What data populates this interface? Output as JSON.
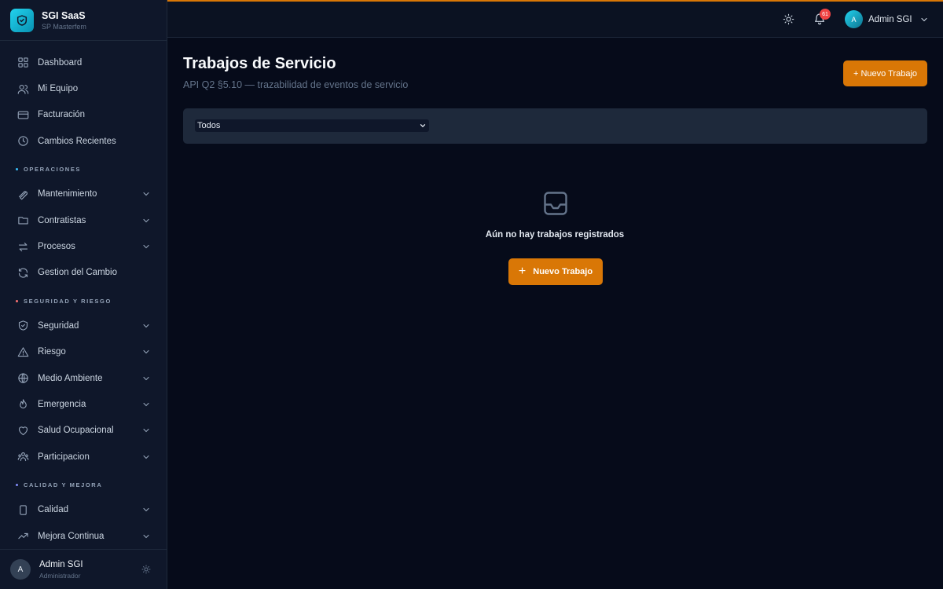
{
  "brand": {
    "name": "SGI SaaS",
    "subtitle": "SP Masterfem"
  },
  "nav_top": [
    {
      "label": "Dashboard",
      "icon": "grid-icon"
    },
    {
      "label": "Mi Equipo",
      "icon": "users-icon"
    },
    {
      "label": "Facturación",
      "icon": "credit-card-icon"
    },
    {
      "label": "Cambios Recientes",
      "icon": "clock-icon"
    }
  ],
  "sections": [
    {
      "title": "OPERACIONES",
      "dot_color": "#38bdf8",
      "items": [
        {
          "label": "Mantenimiento",
          "expandable": true
        },
        {
          "label": "Contratistas",
          "expandable": true
        },
        {
          "label": "Procesos",
          "expandable": true
        },
        {
          "label": "Gestion del Cambio",
          "expandable": false
        }
      ]
    },
    {
      "title": "SEGURIDAD Y RIESGO",
      "dot_color": "#f87171",
      "items": [
        {
          "label": "Seguridad",
          "expandable": true
        },
        {
          "label": "Riesgo",
          "expandable": true
        },
        {
          "label": "Medio Ambiente",
          "expandable": true
        },
        {
          "label": "Emergencia",
          "expandable": true
        },
        {
          "label": "Salud Ocupacional",
          "expandable": true
        },
        {
          "label": "Participacion",
          "expandable": true
        }
      ]
    },
    {
      "title": "CALIDAD Y MEJORA",
      "dot_color": "#818cf8",
      "items": [
        {
          "label": "Calidad",
          "expandable": true
        },
        {
          "label": "Mejora Continua",
          "expandable": true
        }
      ]
    }
  ],
  "user": {
    "initial": "A",
    "name": "Admin SGI",
    "role": "Administrador"
  },
  "topbar": {
    "notification_count": "61",
    "user_name": "Admin SGI",
    "user_initial": "A"
  },
  "page": {
    "title": "Trabajos de Servicio",
    "subtitle": "API Q2 §5.10 — trazabilidad de eventos de servicio",
    "new_button": "+ Nuevo Trabajo",
    "filter_value": "Todos",
    "empty_text": "Aún no hay trabajos registrados",
    "empty_button": "Nuevo Trabajo"
  },
  "colors": {
    "accent": "#d97706",
    "brand": "#22d3ee",
    "badge": "#ef4444"
  }
}
